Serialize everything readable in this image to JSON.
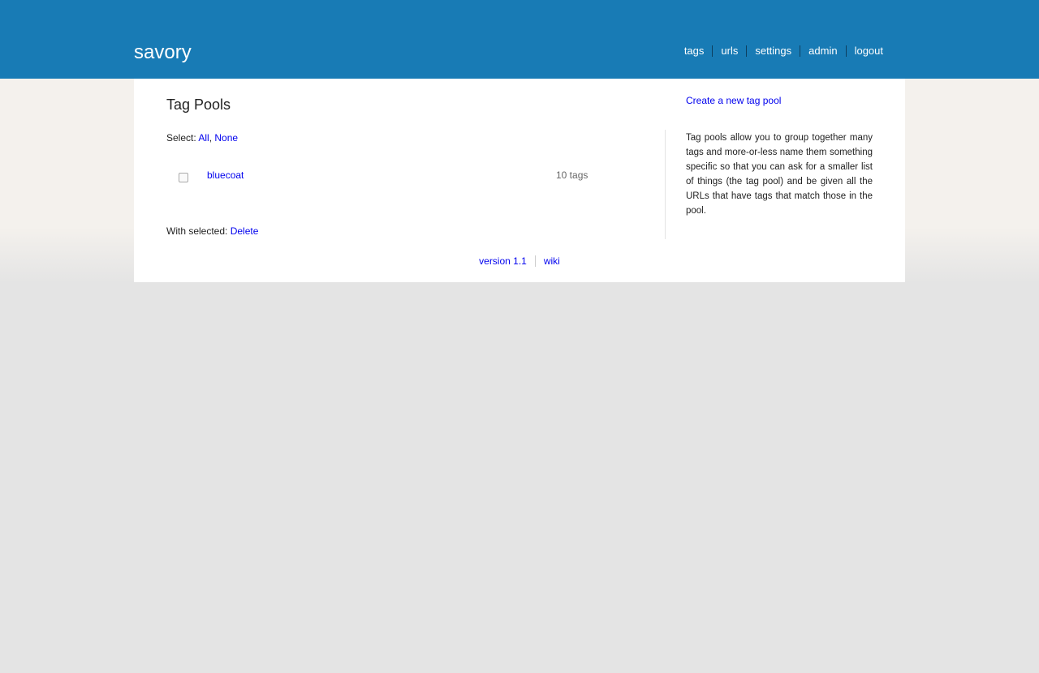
{
  "header": {
    "brand": "savory",
    "nav": [
      {
        "label": "tags"
      },
      {
        "label": "urls"
      },
      {
        "label": "settings"
      },
      {
        "label": "admin"
      },
      {
        "label": "logout"
      }
    ]
  },
  "main": {
    "title": "Tag Pools",
    "select_label": "Select:",
    "select_all": "All",
    "select_sep": ",",
    "select_none": "None",
    "pools": [
      {
        "name": "bluecoat",
        "count": "10 tags",
        "checked": false
      }
    ],
    "with_selected_label": "With selected:",
    "delete_label": "Delete"
  },
  "sidebar": {
    "create_link": "Create a new tag pool",
    "description": "Tag pools allow you to group together many tags and more-or-less name them something specific so that you can ask for a smaller list of things (the tag pool) and be given all the URLs that have tags that match those in the pool."
  },
  "footer": {
    "links": [
      {
        "label": "version 1.1"
      },
      {
        "label": "wiki"
      }
    ]
  },
  "colors": {
    "header_bg": "#187bb5",
    "link": "#0000ee",
    "panel_bg": "#ffffff",
    "page_bg": "#e4e4e4"
  }
}
